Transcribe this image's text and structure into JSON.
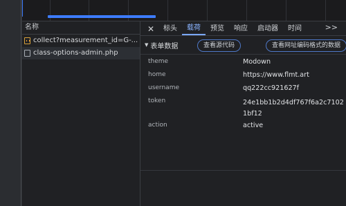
{
  "network_list": {
    "header": "名称",
    "rows": [
      {
        "name": "collect?measurement_id=G-...",
        "icon": "js-file-icon"
      },
      {
        "name": "class-options-admin.php",
        "icon": "php-file-icon"
      }
    ]
  },
  "detail_tabs": {
    "close_label": "✕",
    "tabs": [
      "标头",
      "载荷",
      "预览",
      "响应",
      "启动器",
      "时间"
    ],
    "active_tab": "载荷",
    "more_label": ">>"
  },
  "payload": {
    "section_label": "表单数据",
    "view_source_label": "查看源代码",
    "view_url_encoded_label": "查看网址编码格式的数据",
    "params": [
      {
        "key": "theme",
        "value": "Modown"
      },
      {
        "key": "home",
        "value": "https://www.flmt.art"
      },
      {
        "key": "username",
        "value": "qq222cc921627f"
      },
      {
        "key": "token",
        "value": "24e1bb1b2d4df767f6a2c71021bf12"
      },
      {
        "key": "action",
        "value": "active"
      }
    ]
  },
  "colors": {
    "accent": "#7aa7ff",
    "background": "#202124",
    "border": "#3b3e43"
  }
}
